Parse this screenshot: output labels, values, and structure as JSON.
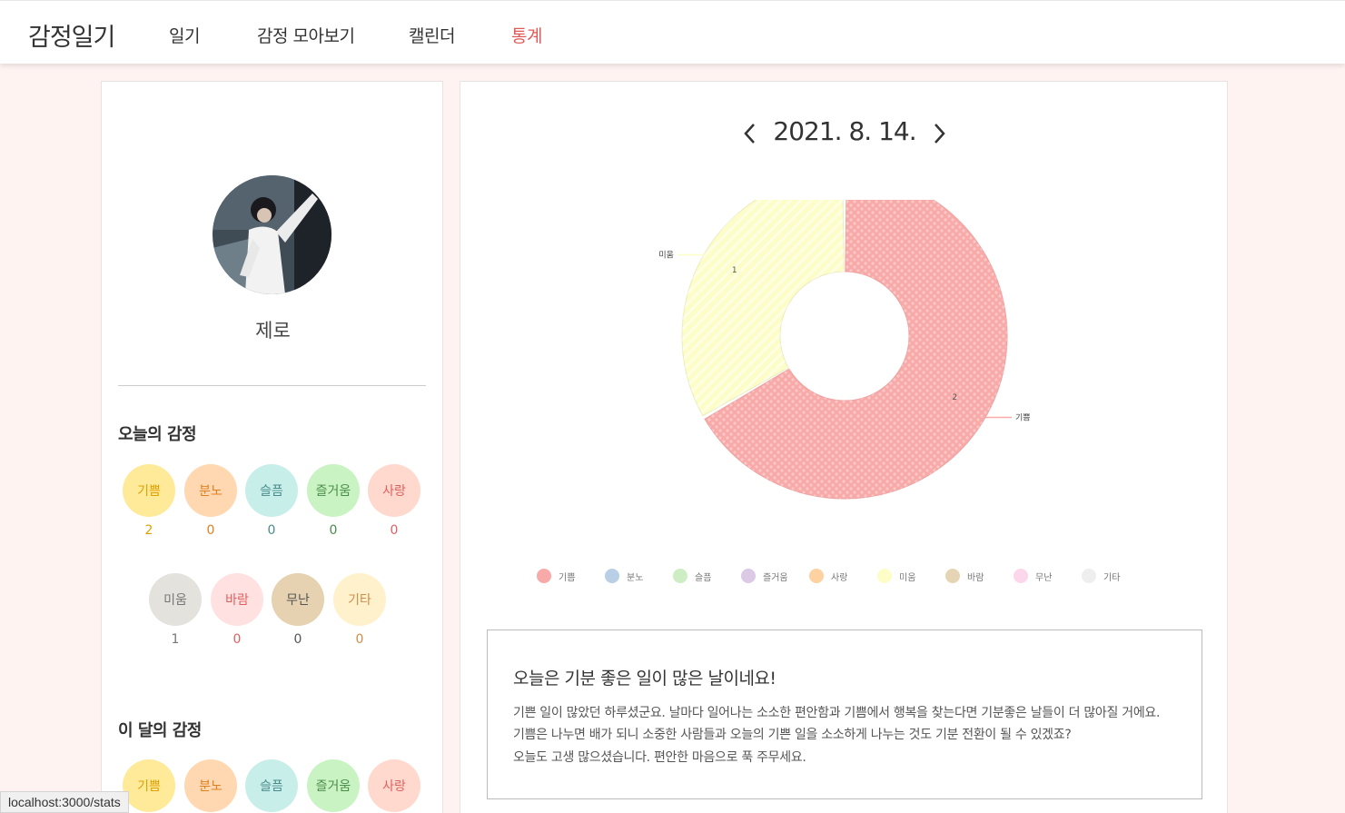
{
  "nav": {
    "brand": "감정일기",
    "links": [
      "일기",
      "감정 모아보기",
      "캘린더",
      "통계"
    ],
    "active_index": 3,
    "active_color": "#e05a5a"
  },
  "profile": {
    "name": "제로"
  },
  "today": {
    "title": "오늘의 감정",
    "emotions": [
      {
        "label": "기쁨",
        "count": "2",
        "bg": "#ffea9a",
        "color": "#e0a000"
      },
      {
        "label": "분노",
        "count": "0",
        "bg": "#ffd7b0",
        "color": "#e08020"
      },
      {
        "label": "슬픔",
        "count": "0",
        "bg": "#c8eeea",
        "color": "#4a8c8c"
      },
      {
        "label": "즐거움",
        "count": "0",
        "bg": "#c9f3c2",
        "color": "#4a8c4a"
      },
      {
        "label": "사랑",
        "count": "0",
        "bg": "#ffd9ce",
        "color": "#e06060"
      },
      {
        "label": "미움",
        "count": "1",
        "bg": "#e3e2dd",
        "color": "#777"
      },
      {
        "label": "바람",
        "count": "0",
        "bg": "#ffe1e1",
        "color": "#e06060"
      },
      {
        "label": "무난",
        "count": "0",
        "bg": "#e6d1b0",
        "color": "#555"
      },
      {
        "label": "기타",
        "count": "0",
        "bg": "#fff1cc",
        "color": "#d08c4a"
      }
    ]
  },
  "month": {
    "title": "이 달의 감정",
    "emotions": [
      {
        "label": "기쁨",
        "bg": "#ffea9a",
        "color": "#e0a000"
      },
      {
        "label": "분노",
        "bg": "#ffd7b0",
        "color": "#e08020"
      },
      {
        "label": "슬픔",
        "bg": "#c8eeea",
        "color": "#4a8c8c"
      },
      {
        "label": "즐거움",
        "bg": "#c9f3c2",
        "color": "#4a8c4a"
      },
      {
        "label": "사랑",
        "bg": "#ffd9ce",
        "color": "#e06060"
      }
    ]
  },
  "date": {
    "text": "2021. 8. 14.",
    "prev_icon": "chevron-left-icon",
    "next_icon": "chevron-right-icon"
  },
  "chart_data": {
    "type": "pie",
    "variant": "donut",
    "slices": [
      {
        "name": "기쁨",
        "value": 2,
        "color": "#f7aaa8",
        "data_label": "2",
        "outer_label": "기쁨"
      },
      {
        "name": "미움",
        "value": 1,
        "color": "#fdfdc8",
        "data_label": "1",
        "outer_label": "미움"
      }
    ],
    "legend": [
      {
        "name": "기쁨",
        "color": "#f7aaa8"
      },
      {
        "name": "분노",
        "color": "#b8cfe6"
      },
      {
        "name": "슬픔",
        "color": "#cdedc4"
      },
      {
        "name": "즐거움",
        "color": "#dbc9e6"
      },
      {
        "name": "사랑",
        "color": "#fdd1a0"
      },
      {
        "name": "미움",
        "color": "#fdfdc8"
      },
      {
        "name": "바람",
        "color": "#e6d5b5"
      },
      {
        "name": "무난",
        "color": "#fcd6ea"
      },
      {
        "name": "기타",
        "color": "#eeeeee"
      }
    ],
    "legend_placement": "bottom"
  },
  "message": {
    "title": "오늘은 기분 좋은 일이 많은 날이네요!",
    "lines": [
      "기쁜 일이 많았던 하루셨군요. 날마다 일어나는 소소한 편안함과 기쁨에서 행복을 찾는다면 기분좋은 날들이 더 많아질 거에요.",
      "기쁨은 나누면 배가 되니 소중한 사람들과 오늘의 기쁜 일을 소소하게 나누는 것도 기분 전환이 될 수 있겠죠?",
      "오늘도 고생 많으셨습니다. 편안한 마음으로 푹 주무세요."
    ]
  },
  "status_bar": {
    "url": "localhost:3000/stats"
  }
}
